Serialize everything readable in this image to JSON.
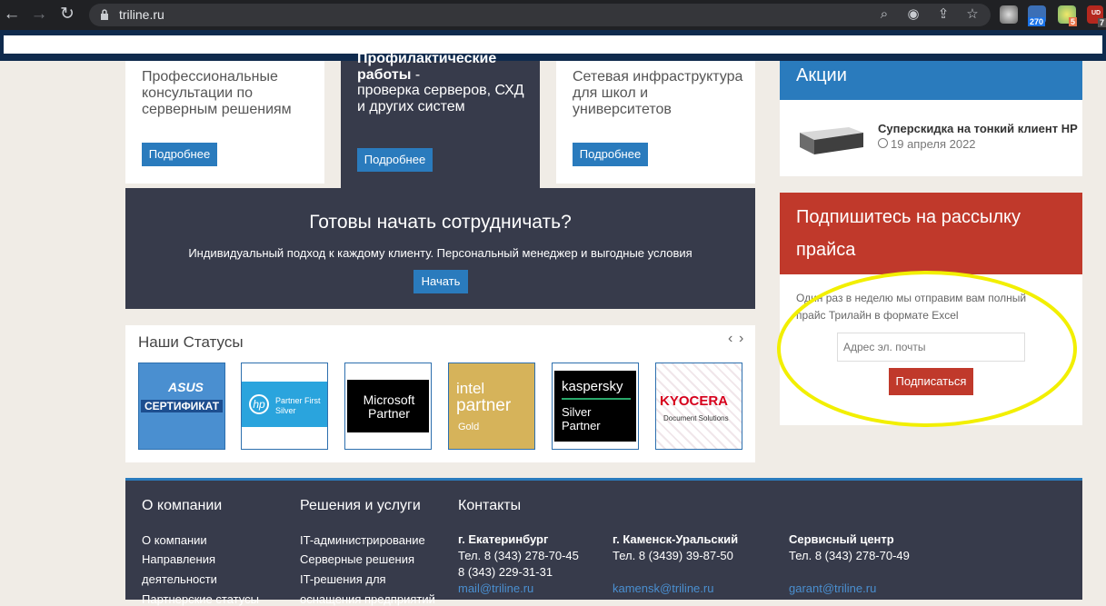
{
  "browser": {
    "url": "triline.ru",
    "badges": {
      "ext2": "270",
      "ext3": "5",
      "ext4": "7",
      "ext4_label": "UD"
    }
  },
  "services": {
    "card1_text": "Профессиональные консультации по серверным решениям",
    "card2_title": "Профилактические работы",
    "card2_dash": " -",
    "card2_text": "проверка серверов, СХД и других систем",
    "card3_text": "Сетевая инфраструктура для школ и университетов",
    "more_label": "Подробнее"
  },
  "cta": {
    "title": "Готовы начать сотрудничать?",
    "subtitle": "Индивидуальный подход к каждому клиенту. Персональный менеджер и выгодные условия",
    "button": "Начать"
  },
  "statuses": {
    "title": "Наши Статусы",
    "prev": "‹",
    "next": "›",
    "logos": [
      {
        "name": "ASUS",
        "text1": "ASUS",
        "text2": "СЕРТИФИКАТ"
      },
      {
        "name": "HP",
        "text1": "hp",
        "text2": "Partner First",
        "text3": "Silver"
      },
      {
        "name": "Microsoft",
        "text1": "Microsoft",
        "text2": "Partner"
      },
      {
        "name": "Intel",
        "text1": "intel",
        "text2": "partner",
        "text3": "Gold"
      },
      {
        "name": "Kaspersky",
        "text1": "kaspersky",
        "text2": "Silver",
        "text3": "Partner"
      },
      {
        "name": "Kyocera",
        "text1": "KYOCERA",
        "text2": "Document Solutions"
      }
    ]
  },
  "promo": {
    "title": "Акции",
    "item_title": "Суперскидка на тонкий клиент HP",
    "item_date": "19 апреля 2022"
  },
  "subscribe": {
    "title_line1": "Подпишитесь на рассылку",
    "title_line2": "прайса",
    "text_line1": "Один раз в неделю мы отправим вам полный",
    "text_line2": "прайс Трилайн в формате Excel",
    "email_placeholder": "Адрес эл. почты",
    "button": "Подписаться"
  },
  "footer": {
    "col1_title": "О компании",
    "col1_links": [
      "О компании",
      "Направления",
      "деятельности",
      "Партнерские статусы"
    ],
    "col2_title": "Решения и услуги",
    "col2_links": [
      "IT-администрирование",
      "Серверные решения",
      "IT-решения для",
      "оснащения предприятий"
    ],
    "col3_title": "Контакты",
    "contacts": [
      {
        "city": "г. Екатеринбург",
        "phone1": "Тел. 8 (343) 278-70-45",
        "phone2": "8 (343) 229-31-31",
        "email": "mail@triline.ru"
      },
      {
        "city": "г. Каменск-Уральский",
        "phone1": "Тел. 8 (3439) 39-87-50",
        "email": "kamensk@triline.ru"
      },
      {
        "city": "Сервисный центр",
        "phone1": "Тел. 8 (343) 278-70-49",
        "email": "garant@triline.ru"
      }
    ]
  },
  "colors": {
    "accent_blue": "#2a7bbd",
    "dark_panel": "#373b4b",
    "red": "#c0392b",
    "highlight": "#f2ef00"
  }
}
